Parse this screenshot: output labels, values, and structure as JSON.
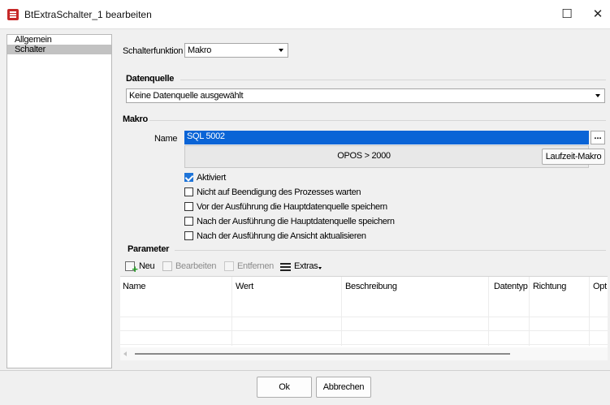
{
  "window": {
    "title": "BtExtraSchalter_1 bearbeiten",
    "maximize_glyph": "☐",
    "close_glyph": "✕"
  },
  "nav": {
    "items": [
      {
        "label": "Allgemein",
        "selected": false
      },
      {
        "label": "Schalter",
        "selected": true
      }
    ]
  },
  "form": {
    "schalterfunktion_label": "Schalterfunktion",
    "schalterfunktion_value": "Makro",
    "datenquelle_heading": "Datenquelle",
    "datenquelle_value": "Keine Datenquelle ausgewählt",
    "makro_heading": "Makro",
    "name_label": "Name",
    "name_value": "SQL 5002",
    "browse_label": "...",
    "macro_description": "OPOS > 2000",
    "laufzeit_button": "Laufzeit-Makro",
    "checkboxes": [
      {
        "label": "Aktiviert",
        "checked": true
      },
      {
        "label": "Nicht auf Beendigung des Prozesses warten",
        "checked": false
      },
      {
        "label": "Vor der Ausführung die Hauptdatenquelle speichern",
        "checked": false
      },
      {
        "label": "Nach der Ausführung die Hauptdatenquelle speichern",
        "checked": false
      },
      {
        "label": "Nach der Ausführung die Ansicht aktualisieren",
        "checked": false
      }
    ]
  },
  "parameter": {
    "heading": "Parameter",
    "toolbar": {
      "new": "Neu",
      "edit": "Bearbeiten",
      "remove": "Entfernen",
      "extras": "Extras"
    },
    "columns": [
      "Name",
      "Wert",
      "Beschreibung",
      "Datentyp",
      "Richtung",
      "Opt"
    ],
    "rows": []
  },
  "footer": {
    "ok": "Ok",
    "cancel": "Abbrechen"
  },
  "colors": {
    "selection_blue": "#0a64d6",
    "checkbox_blue": "#1e74d8",
    "app_icon_red": "#c62828"
  }
}
